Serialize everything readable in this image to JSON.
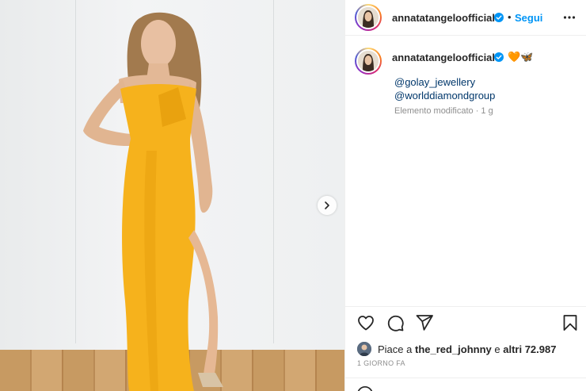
{
  "post": {
    "account": "annatatangeloofficial",
    "follow_label": "Segui",
    "dot": "•",
    "caption_emojis": "🧡🦋",
    "mentions": [
      "@golay_jewellery",
      "@worlddiamondgroup"
    ],
    "edited_meta": "Elemento modificato · 1 g",
    "likes_prefix": "Piace a ",
    "likes_user": "the_red_johnny",
    "likes_middle": " e ",
    "likes_others": "altri 72.987",
    "time_ago": "1 GIORNO FA"
  },
  "colors": {
    "link_blue": "#0095f6",
    "mention_blue": "#00376b",
    "dress_yellow": "#f6b21c",
    "meta_gray": "#8e8e8e"
  },
  "icons": {
    "verified": "verified-badge-icon",
    "more": "more-options-icon",
    "like": "heart-icon",
    "comment": "comment-icon",
    "share": "share-icon",
    "save": "bookmark-icon",
    "next": "chevron-right-icon",
    "emoji": "emoji-icon"
  }
}
